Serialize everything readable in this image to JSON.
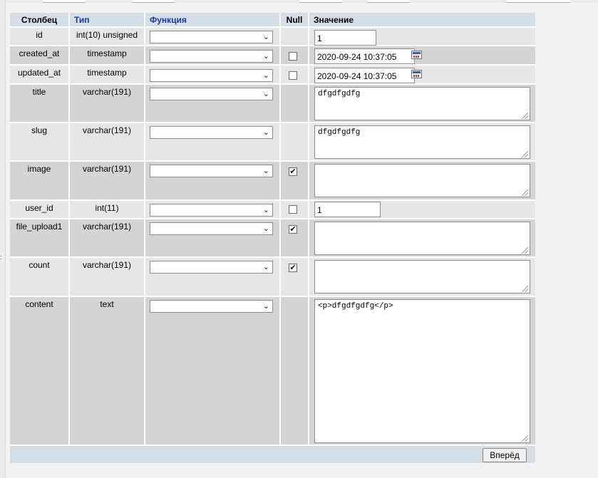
{
  "headers": {
    "column": "Столбец",
    "type": "Тип",
    "function": "Функция",
    "null": "Null",
    "value": "Значение"
  },
  "rows": [
    {
      "name": "id",
      "type": "int(10) unsigned",
      "null_checked": null,
      "value": "1"
    },
    {
      "name": "created_at",
      "type": "timestamp",
      "null_checked": false,
      "value": "2020-09-24 10:37:05"
    },
    {
      "name": "updated_at",
      "type": "timestamp",
      "null_checked": false,
      "value": "2020-09-24 10:37:05"
    },
    {
      "name": "title",
      "type": "varchar(191)",
      "null_checked": null,
      "value": "dfgdfgdfg"
    },
    {
      "name": "slug",
      "type": "varchar(191)",
      "null_checked": null,
      "value": "dfgdfgdfg"
    },
    {
      "name": "image",
      "type": "varchar(191)",
      "null_checked": true,
      "value": ""
    },
    {
      "name": "user_id",
      "type": "int(11)",
      "null_checked": false,
      "value": "1"
    },
    {
      "name": "file_upload1",
      "type": "varchar(191)",
      "null_checked": true,
      "value": ""
    },
    {
      "name": "count",
      "type": "varchar(191)",
      "null_checked": true,
      "value": ""
    },
    {
      "name": "content",
      "type": "text",
      "null_checked": null,
      "value": "<p>dfgdfgdfg</p>"
    }
  ],
  "checkmark": "✔",
  "chevron": "⌄",
  "submit_label": "Вперёд"
}
